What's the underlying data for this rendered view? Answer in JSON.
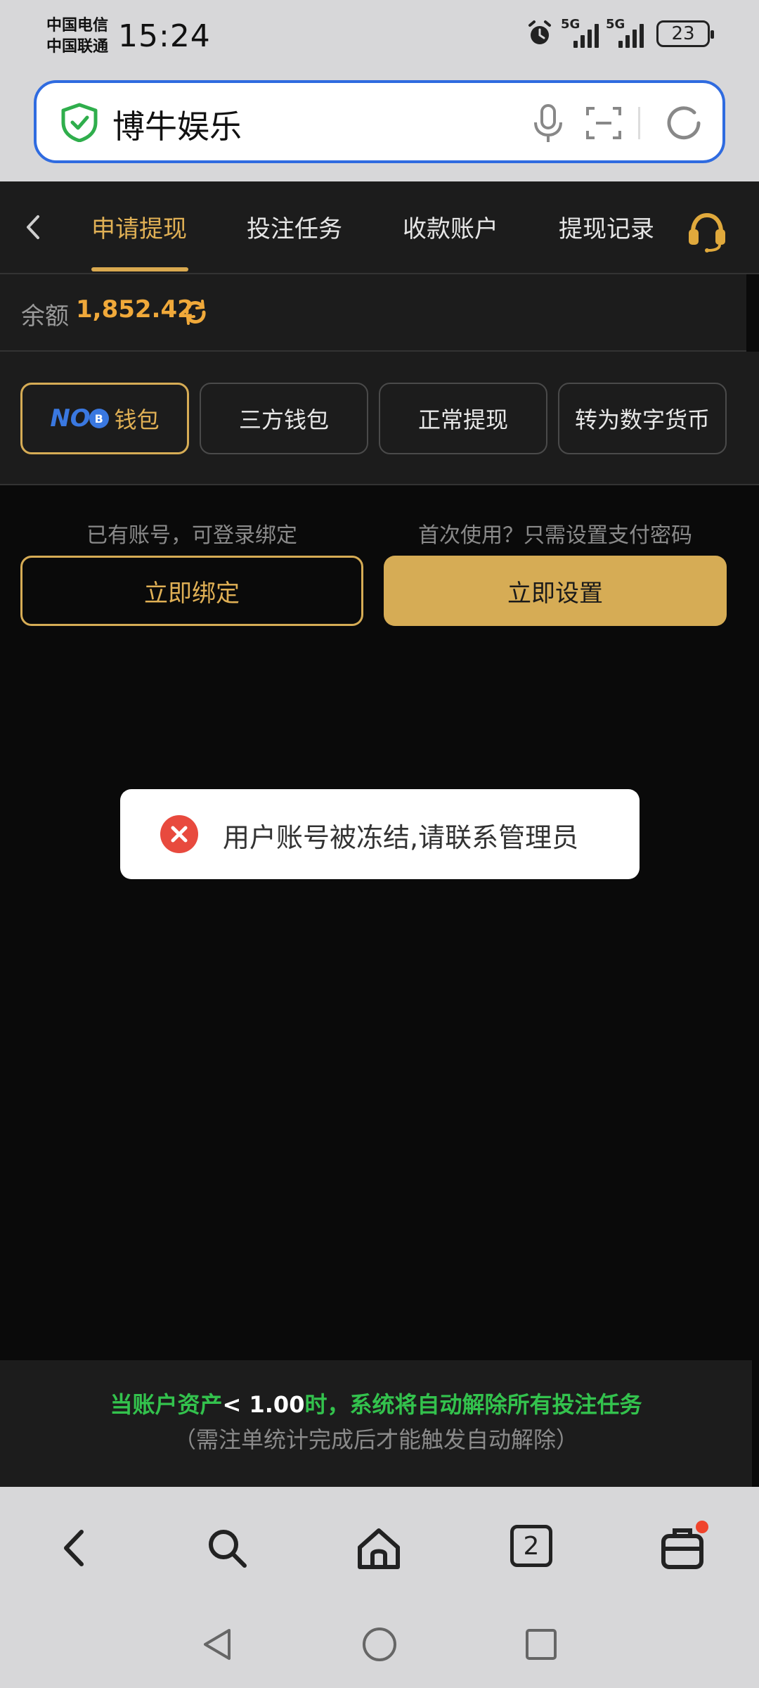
{
  "status_bar": {
    "carrier1": "中国电信",
    "carrier2": "中国联通",
    "time": "15:24",
    "signal1_label": "5G",
    "signal2_label": "5G",
    "battery": "23",
    "icons": [
      "alarm-icon",
      "signal-icon",
      "signal-icon",
      "battery-icon"
    ]
  },
  "browser": {
    "url_text": "博牛娱乐",
    "icons": [
      "shield-check-icon",
      "microphone-icon",
      "scan-icon",
      "refresh-icon"
    ],
    "accent_color": "#2f6be0"
  },
  "tabs": [
    {
      "label": "申请提现",
      "active": true
    },
    {
      "label": "投注任务",
      "active": false
    },
    {
      "label": "收款账户",
      "active": false
    },
    {
      "label": "提现记录",
      "active": false
    }
  ],
  "balance": {
    "label": "余额",
    "value": "1,852.42"
  },
  "wallets": [
    {
      "label": "钱包",
      "logo": "NO",
      "logo_badge": "B",
      "active": true
    },
    {
      "label": "三方钱包",
      "active": false
    },
    {
      "label": "正常提现",
      "active": false
    },
    {
      "label": "转为数字货币",
      "active": false
    }
  ],
  "bind": {
    "hint_left": "已有账号，可登录绑定",
    "hint_right": "首次使用？只需设置支付密码",
    "bind_label": "立即绑定",
    "setup_label": "立即设置"
  },
  "toast": {
    "message": "用户账号被冻结,请联系管理员"
  },
  "notice": {
    "line1_prefix": "当账户资产",
    "line1_highlight": "< 1.00",
    "line1_suffix": "时，系统将自动解除所有投注任务",
    "line2": "（需注单统计完成后才能触发自动解除）"
  },
  "browser_nav": {
    "tab_count": "2"
  },
  "colors": {
    "gold": "#d6ac55",
    "balance_orange": "#f0a93a",
    "notice_green": "#33c24d",
    "error_red": "#e84a3e"
  }
}
